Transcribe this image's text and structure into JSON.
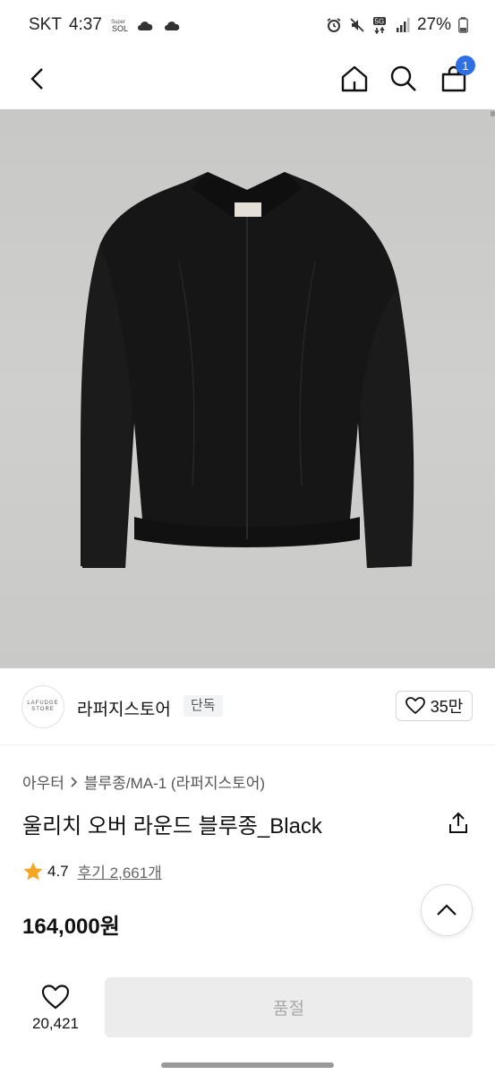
{
  "status_bar": {
    "carrier": "SKT",
    "time": "4:37",
    "network": "5G",
    "battery": "27%",
    "icons": [
      "super-sol-icon",
      "cloud-icon",
      "cloud-icon",
      "alarm-icon",
      "mute-icon",
      "wifi-icon",
      "signal-icon",
      "battery-icon"
    ]
  },
  "nav": {
    "cart_count": "1",
    "icons": [
      "back-icon",
      "home-icon",
      "search-icon",
      "cart-icon"
    ]
  },
  "brand": {
    "logo_text": "LAFUDGE STORE",
    "name": "라퍼지스토어",
    "tag": "단독",
    "likes": "35만"
  },
  "product": {
    "breadcrumb": [
      "아우터",
      "블루종/MA-1 (라퍼지스토어)"
    ],
    "title": "울리치 오버 라운드 블루종_Black",
    "rating": "4.7",
    "reviews": "후기 2,661개",
    "price": "164,000원"
  },
  "bottom": {
    "wish_count": "20,421",
    "action_label": "품절"
  },
  "colors": {
    "accent": "#2f6fe4",
    "rating_star": "#f5a623",
    "image_background": "#cbcbc9",
    "soldout_bg": "#ececec"
  }
}
